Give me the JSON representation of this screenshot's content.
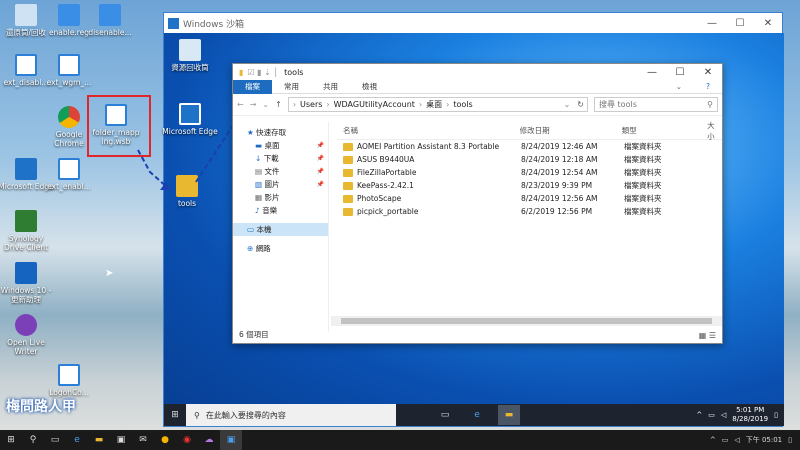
{
  "desktop_icons": [
    {
      "label": "還原筒/回收"
    },
    {
      "label": "enable.reg"
    },
    {
      "label": "disenable..."
    },
    {
      "label": "ext_disabl..."
    },
    {
      "label": "ext_wgm_..."
    },
    {
      "label": "Google Chrome"
    },
    {
      "label": "folder_mapp ing.wsb"
    },
    {
      "label": "Microsoft Edge"
    },
    {
      "label": "ext_enabl..."
    },
    {
      "label": "Synology Drive Client"
    },
    {
      "label": "Windows 10 - 更新助理"
    },
    {
      "label": "Open Live Writer"
    },
    {
      "label": "LogonCo..."
    }
  ],
  "sandbox": {
    "title": "Windows 沙箱",
    "recycle_label": "資源回收筒",
    "edge_label": "Microsoft Edge",
    "tools_label": "tools"
  },
  "explorer": {
    "title": "tools",
    "ribbon": [
      "檔案",
      "常用",
      "共用",
      "檢視"
    ],
    "path": [
      "Users",
      "WDAGUtilityAccount",
      "桌面",
      "tools"
    ],
    "search_placeholder": "搜尋 tools",
    "nav": [
      {
        "label": "快速存取",
        "pin": false
      },
      {
        "label": "桌面",
        "pin": true
      },
      {
        "label": "下載",
        "pin": true
      },
      {
        "label": "文件",
        "pin": true
      },
      {
        "label": "圖片",
        "pin": true
      },
      {
        "label": "影片",
        "pin": false
      },
      {
        "label": "音樂",
        "pin": false
      },
      {
        "label": "本機",
        "pin": false
      },
      {
        "label": "網路",
        "pin": false
      }
    ],
    "columns": [
      "名稱",
      "修改日期",
      "類型",
      "大小"
    ],
    "rows": [
      {
        "name": "AOMEI Partition Assistant 8.3 Portable",
        "date": "8/24/2019 12:46 AM",
        "type": "檔案資料夾"
      },
      {
        "name": "ASUS B9440UA",
        "date": "8/24/2019 12:18 AM",
        "type": "檔案資料夾"
      },
      {
        "name": "FileZillaPortable",
        "date": "8/24/2019 12:54 AM",
        "type": "檔案資料夾"
      },
      {
        "name": "KeePass-2.42.1",
        "date": "8/23/2019 9:39 PM",
        "type": "檔案資料夾"
      },
      {
        "name": "PhotoScape",
        "date": "8/24/2019 12:56 AM",
        "type": "檔案資料夾"
      },
      {
        "name": "picpick_portable",
        "date": "6/2/2019 12:56 PM",
        "type": "檔案資料夾"
      }
    ],
    "status": "6 個項目"
  },
  "sandbox_taskbar": {
    "search_placeholder": "在此輸入要搜尋的內容",
    "time": "5:01 PM",
    "date": "8/28/2019"
  },
  "host_taskbar": {
    "clock": "下午 05:01"
  },
  "watermark": "梅問路人甲"
}
